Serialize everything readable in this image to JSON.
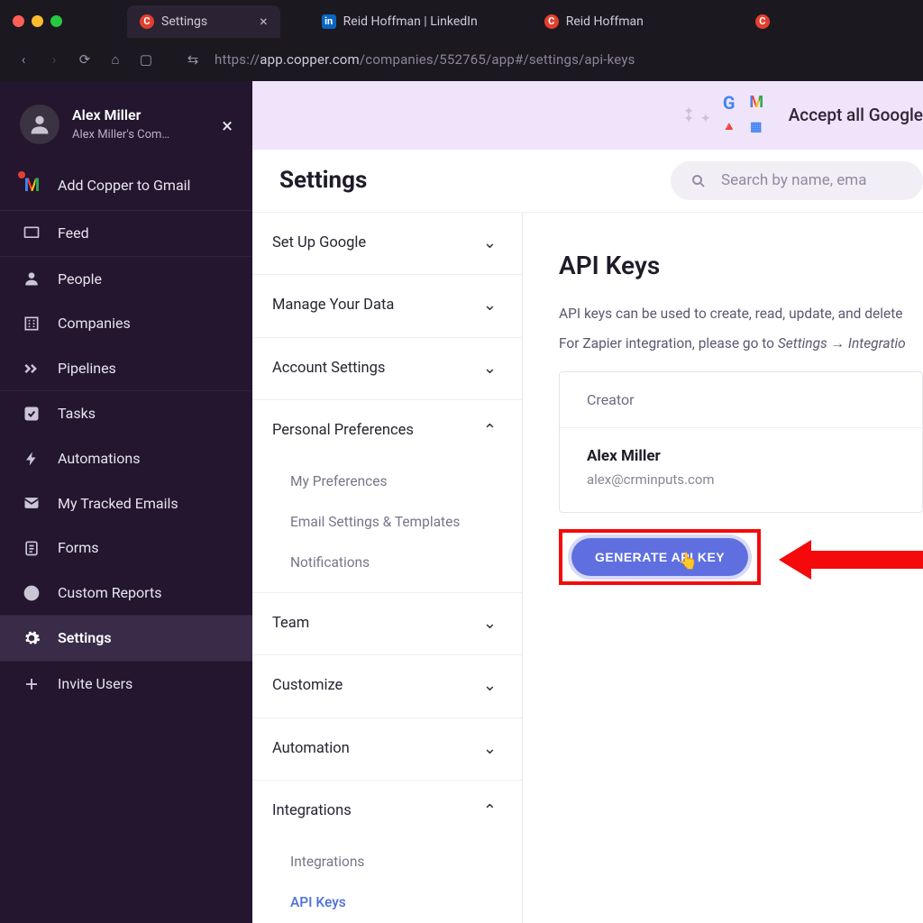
{
  "browser": {
    "tabs": [
      {
        "label": "Settings",
        "icon": "copper"
      },
      {
        "label": "Reid Hoffman | LinkedIn",
        "icon": "linkedin"
      },
      {
        "label": "Reid Hoffman",
        "icon": "copper"
      }
    ],
    "url_prefix": "https://",
    "url_host": "app.copper.com",
    "url_path": "/companies/552765/app#/settings/api-keys"
  },
  "sidebar": {
    "user_name": "Alex Miller",
    "user_sub": "Alex Miller's Com…",
    "gmail_label": "Add Copper to Gmail",
    "items": [
      {
        "label": "Feed",
        "icon": "monitor"
      },
      {
        "label": "People",
        "icon": "person"
      },
      {
        "label": "Companies",
        "icon": "building"
      },
      {
        "label": "Pipelines",
        "icon": "chevrons"
      },
      {
        "label": "Tasks",
        "icon": "check"
      },
      {
        "label": "Automations",
        "icon": "bolt"
      },
      {
        "label": "My Tracked Emails",
        "icon": "mail"
      },
      {
        "label": "Forms",
        "icon": "clipboard"
      },
      {
        "label": "Custom Reports",
        "icon": "pie"
      },
      {
        "label": "Settings",
        "icon": "gear"
      },
      {
        "label": "Invite Users",
        "icon": "plus"
      }
    ]
  },
  "banner": {
    "text": "Accept all Google"
  },
  "header": {
    "title": "Settings",
    "search_placeholder": "Search by name, ema"
  },
  "settings_nav": {
    "groups": [
      {
        "label": "Set Up Google",
        "expanded": false
      },
      {
        "label": "Manage Your Data",
        "expanded": false
      },
      {
        "label": "Account Settings",
        "expanded": false
      },
      {
        "label": "Personal Preferences",
        "expanded": true,
        "children": [
          "My Preferences",
          "Email Settings & Templates",
          "Notifications"
        ]
      },
      {
        "label": "Team",
        "expanded": false
      },
      {
        "label": "Customize",
        "expanded": false
      },
      {
        "label": "Automation",
        "expanded": false
      },
      {
        "label": "Integrations",
        "expanded": true,
        "children": [
          "Integrations",
          "API Keys"
        ],
        "active_child": "API Keys"
      }
    ]
  },
  "panel": {
    "title": "API Keys",
    "desc1": "API keys can be used to create, read, update, and delete",
    "desc2_a": "For Zapier integration, please go to ",
    "desc2_b": "Settings → Integratio",
    "card_header": "Creator",
    "creator_name": "Alex Miller",
    "creator_email": "alex@crminputs.com",
    "button": "GENERATE API KEY"
  }
}
